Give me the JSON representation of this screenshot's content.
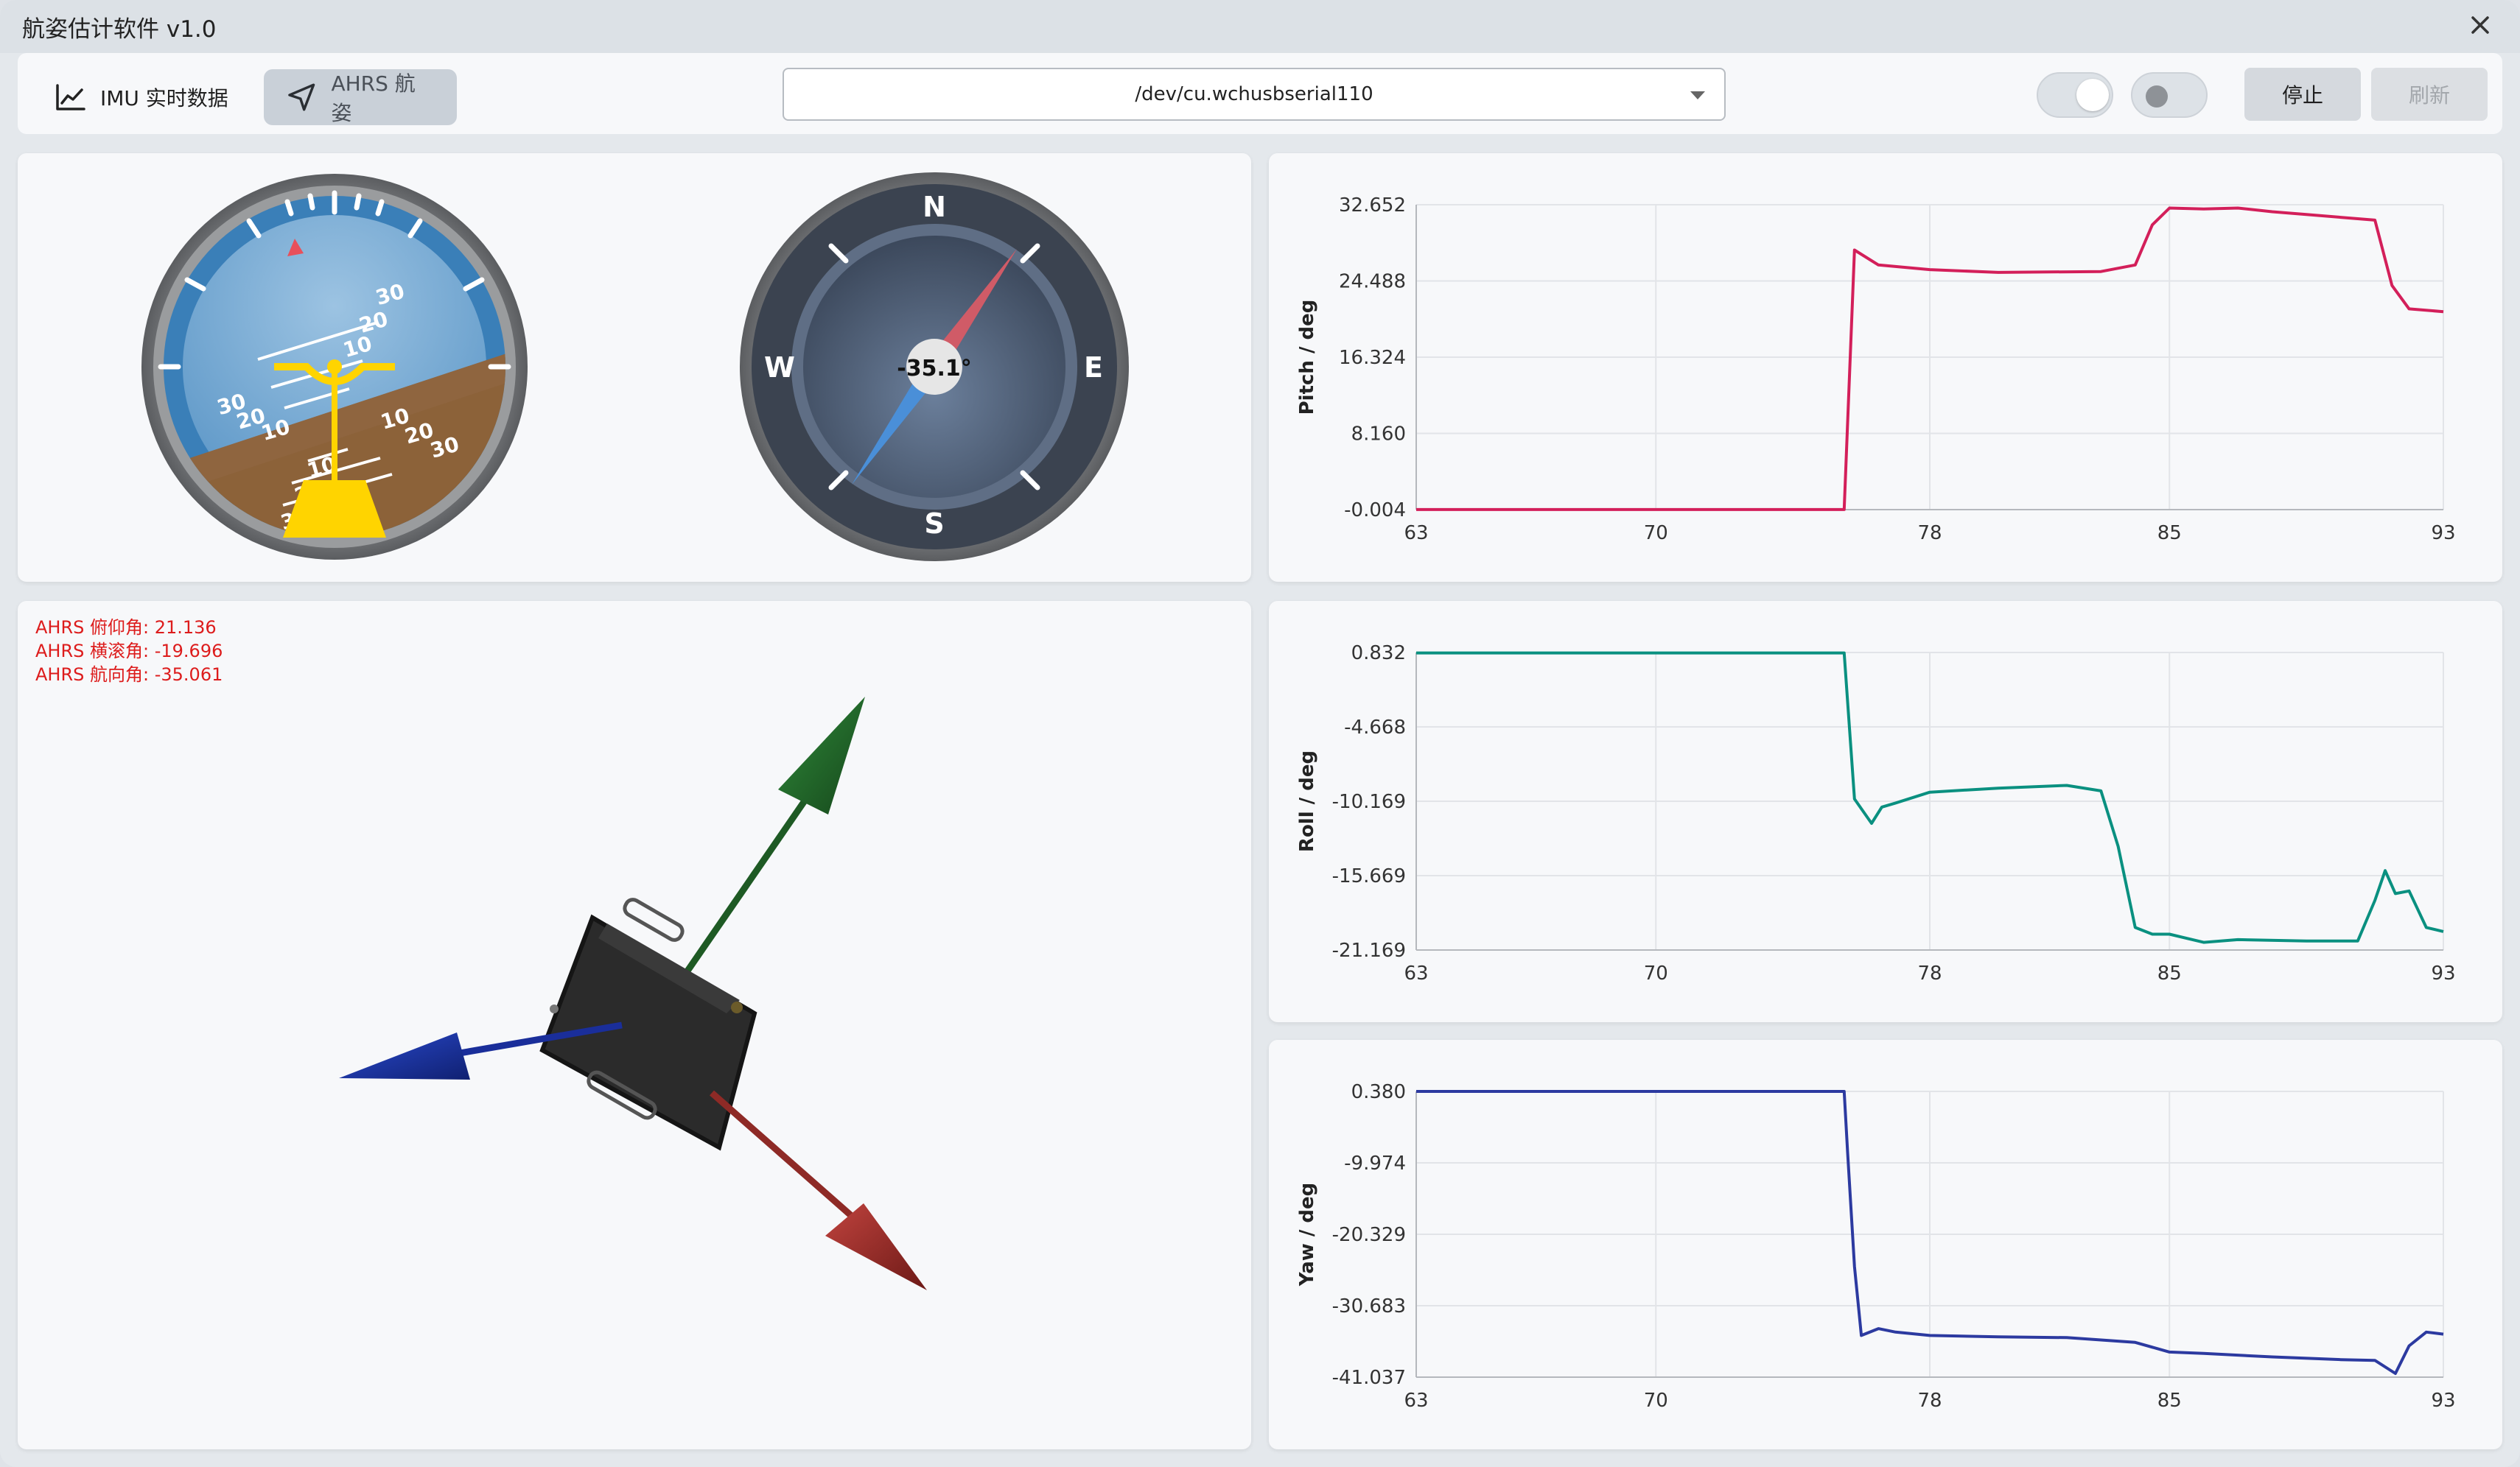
{
  "window": {
    "title": "航姿估计软件 v1.0"
  },
  "toolbar": {
    "tab_imu": "IMU 实时数据",
    "tab_ahrs": "AHRS 航姿",
    "serial_port": "/dev/cu.wchusbserial110",
    "stop_label": "停止",
    "refresh_label": "刷新"
  },
  "instruments": {
    "attitude": {
      "pitch_marks": [
        "30",
        "20",
        "10",
        "10",
        "20",
        "30"
      ]
    },
    "compass": {
      "heading_text": "-35.1°",
      "north": "N",
      "south": "S",
      "east": "E",
      "west": "W"
    }
  },
  "ahrs_info": {
    "pitch": "AHRS 俯仰角: 21.136",
    "roll": "AHRS 横滚角: -19.696",
    "yaw": "AHRS 航向角: -35.061"
  },
  "colors": {
    "pitch": "#d31f5a",
    "roll": "#0a9080",
    "yaw": "#2c3aa0"
  },
  "chart_data": [
    {
      "type": "line",
      "ylabel": "Pitch / deg",
      "xlabel": "",
      "xlim": [
        63,
        93
      ],
      "ylim": [
        -0.004,
        32.652
      ],
      "xticks": [
        "63",
        "70",
        "78",
        "85",
        "93"
      ],
      "yticks": [
        "32.652",
        "24.488",
        "16.324",
        "8.160",
        "-0.004"
      ],
      "series": [
        {
          "x": [
            63,
            75,
            75.5,
            75.8,
            76.5,
            78,
            80,
            83,
            84,
            84.5,
            85,
            86,
            87,
            88,
            89,
            90,
            91,
            91.5,
            92,
            93
          ],
          "y": [
            0.0,
            0.0,
            0.0,
            27.8,
            26.2,
            25.7,
            25.4,
            25.5,
            26.2,
            30.5,
            32.3,
            32.2,
            32.3,
            31.9,
            31.6,
            31.3,
            31.0,
            24.0,
            21.5,
            21.2
          ]
        }
      ]
    },
    {
      "type": "line",
      "ylabel": "Roll / deg",
      "xlabel": "",
      "xlim": [
        63,
        93
      ],
      "ylim": [
        -21.169,
        0.832
      ],
      "xticks": [
        "63",
        "70",
        "78",
        "85",
        "93"
      ],
      "yticks": [
        "0.832",
        "-4.668",
        "-10.169",
        "-15.669",
        "-21.169"
      ],
      "series": [
        {
          "x": [
            63,
            75,
            75.5,
            75.8,
            76.3,
            76.6,
            77,
            78,
            80,
            82,
            83,
            83.5,
            84,
            84.5,
            85,
            86,
            87,
            89,
            90.5,
            91,
            91.3,
            91.6,
            92,
            92.5,
            93
          ],
          "y": [
            0.8,
            0.8,
            0.8,
            -10.0,
            -11.8,
            -10.6,
            -10.3,
            -9.5,
            -9.2,
            -9.0,
            -9.4,
            -13.5,
            -19.5,
            -20.0,
            -20.0,
            -20.6,
            -20.4,
            -20.5,
            -20.5,
            -17.5,
            -15.3,
            -17.0,
            -16.8,
            -19.5,
            -19.8
          ]
        }
      ]
    },
    {
      "type": "line",
      "ylabel": "Yaw / deg",
      "xlabel": "",
      "xlim": [
        63,
        93
      ],
      "ylim": [
        -41.037,
        0.38
      ],
      "xticks": [
        "63",
        "70",
        "78",
        "85",
        "93"
      ],
      "yticks": [
        "0.380",
        "-9.974",
        "-20.329",
        "-30.683",
        "-41.037"
      ],
      "series": [
        {
          "x": [
            63,
            75.5,
            75.6,
            75.8,
            76.0,
            76.5,
            77,
            78,
            80,
            82,
            84,
            85,
            86,
            88,
            90,
            91,
            91.6,
            92,
            92.5,
            93
          ],
          "y": [
            0.38,
            0.38,
            -8.5,
            -25.0,
            -35.0,
            -34.0,
            -34.5,
            -35.0,
            -35.2,
            -35.3,
            -36.0,
            -37.4,
            -37.6,
            -38.1,
            -38.5,
            -38.6,
            -40.5,
            -36.5,
            -34.5,
            -34.8
          ]
        }
      ]
    }
  ]
}
